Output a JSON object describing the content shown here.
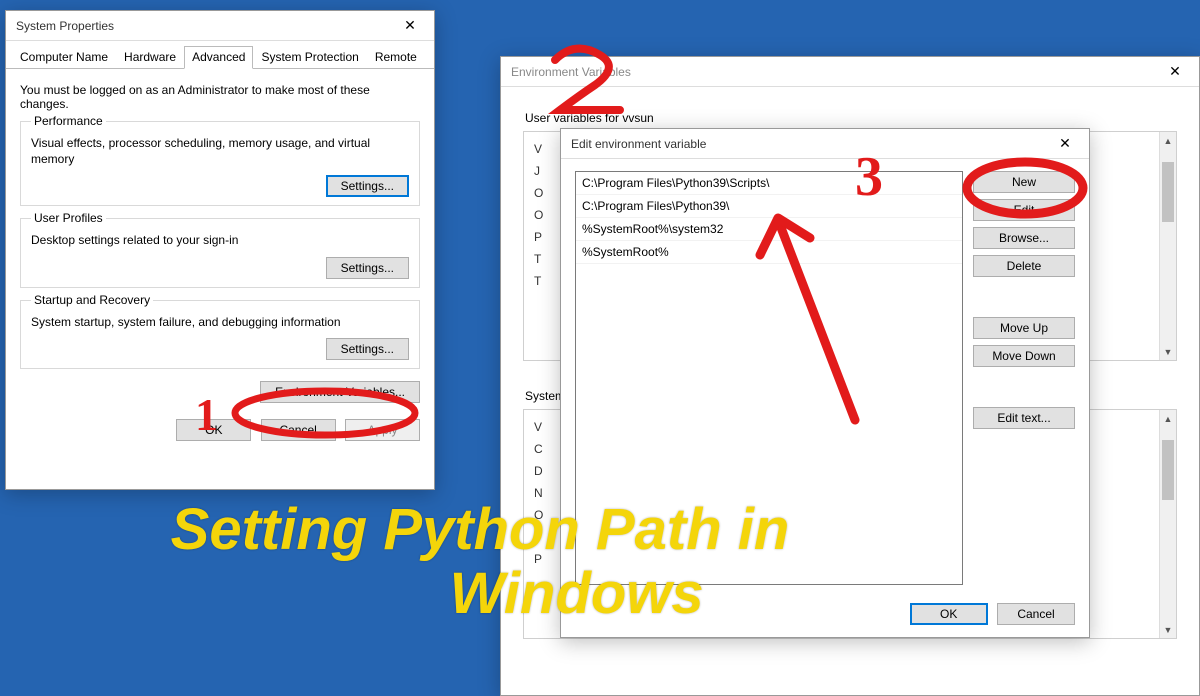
{
  "caption": "Setting Python Path in\n            Windows",
  "annotations": {
    "one": "1",
    "two": "2",
    "three": "3"
  },
  "sysprops": {
    "title": "System Properties",
    "tabs": [
      "Computer Name",
      "Hardware",
      "Advanced",
      "System Protection",
      "Remote"
    ],
    "active_tab_index": 2,
    "intro": "You must be logged on as an Administrator to make most of these changes.",
    "perf": {
      "title": "Performance",
      "text": "Visual effects, processor scheduling, memory usage, and virtual memory",
      "btn": "Settings..."
    },
    "profiles": {
      "title": "User Profiles",
      "text": "Desktop settings related to your sign-in",
      "btn": "Settings..."
    },
    "startup": {
      "title": "Startup and Recovery",
      "text": "System startup, system failure, and debugging information",
      "btn": "Settings..."
    },
    "env_btn": "Environment Variables...",
    "footer": {
      "ok": "OK",
      "cancel": "Cancel",
      "apply": "Apply"
    }
  },
  "envvars": {
    "title": "Environment Variables",
    "user_section": "User variables for vvsun",
    "sys_section": "System variables",
    "rows_left_user": [
      "V",
      "J",
      "O",
      "O",
      "P",
      "T",
      "T"
    ],
    "rows_left_sys": [
      "V",
      "C",
      "D",
      "N",
      "O",
      "P",
      "P"
    ]
  },
  "editenv": {
    "title": "Edit environment variable",
    "entries": [
      "C:\\Program Files\\Python39\\Scripts\\",
      "C:\\Program Files\\Python39\\",
      "%SystemRoot%\\system32",
      "%SystemRoot%"
    ],
    "buttons": {
      "new": "New",
      "edit": "Edit",
      "browse": "Browse...",
      "delete": "Delete",
      "moveup": "Move Up",
      "movedown": "Move Down",
      "edittext": "Edit text...",
      "ok": "OK",
      "cancel": "Cancel"
    }
  }
}
